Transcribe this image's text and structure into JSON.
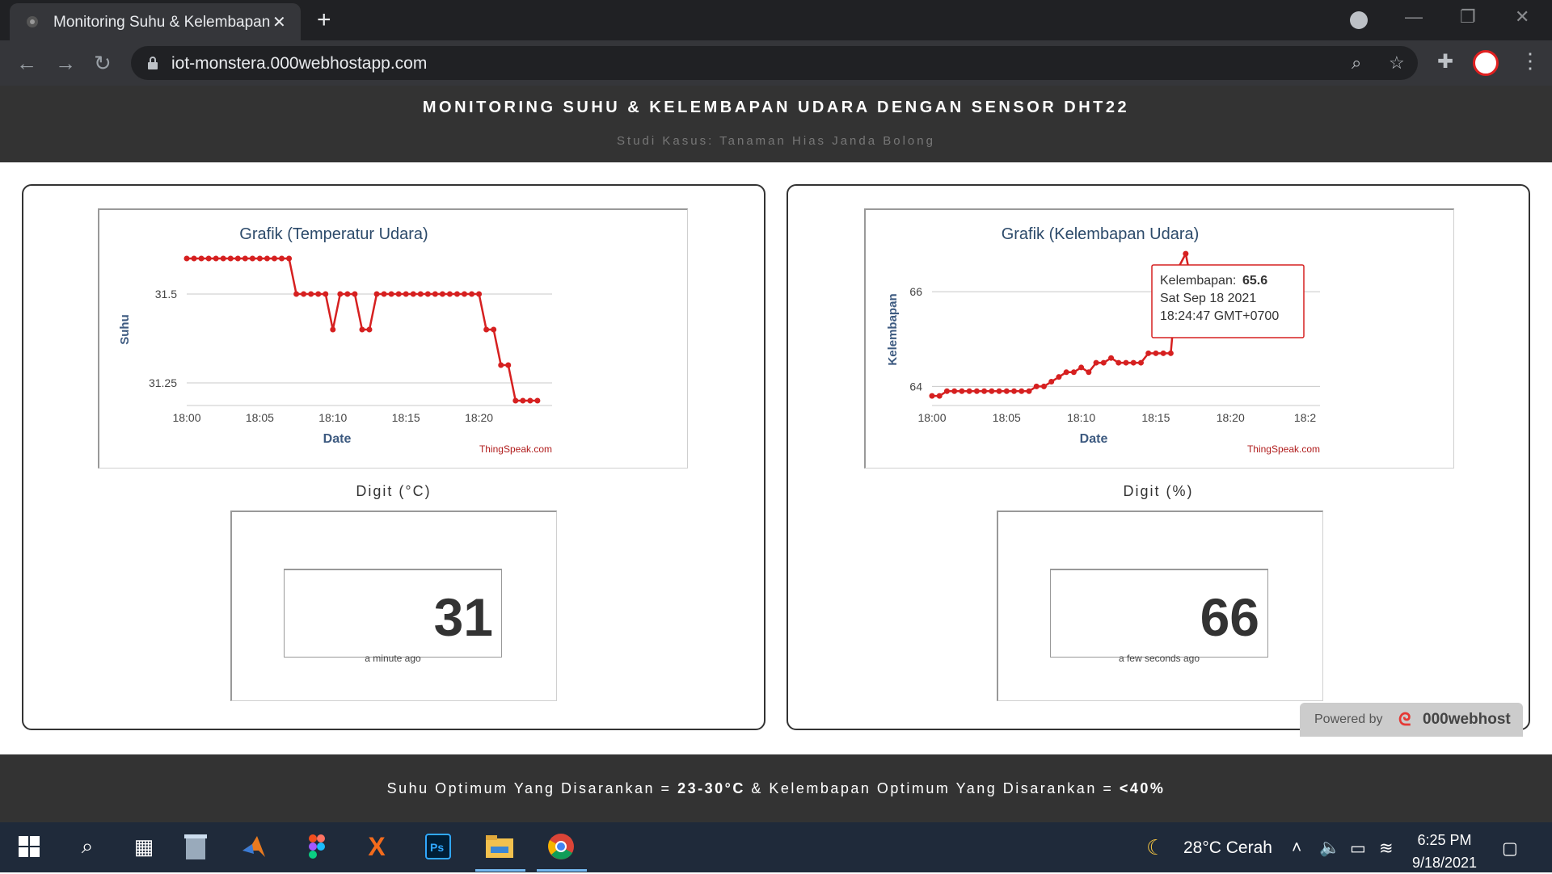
{
  "browser": {
    "tab_title": "Monitoring Suhu & Kelembapan",
    "tab_close": "✕",
    "new_tab": "+",
    "url": "iot-monstera.000webhostapp.com",
    "icons": [
      "back-icon",
      "forward-icon",
      "reload-icon",
      "lock-icon",
      "zoom-icon",
      "star-icon",
      "extensions-icon",
      "menu-icon"
    ]
  },
  "header": {
    "title": "MONITORING SUHU & KELEMBAPAN UDARA DENGAN SENSOR DHT22",
    "subtitle": "Studi Kasus: Tanaman Hias Janda Bolong"
  },
  "temperature": {
    "digit_title": "Digit (°C)",
    "value": "31",
    "updated": "a minute ago"
  },
  "humidity": {
    "digit_title": "Digit (%)",
    "value": "66",
    "updated": "a few seconds ago"
  },
  "footer": {
    "text_1": "Suhu Optimum Yang Disarankan = ",
    "bold_1": "23-30°C",
    "text_2": " & Kelembapan Optimum Yang Disarankan = ",
    "bold_2": "<40%"
  },
  "powered": {
    "label": "Powered by",
    "brand": "000webhost"
  },
  "taskbar": {
    "weather": "28°C  Cerah",
    "time": "6:25 PM",
    "date": "9/18/2021"
  },
  "chart_data": [
    {
      "type": "line",
      "title": "Grafik (Temperatur Udara)",
      "xlabel": "Date",
      "ylabel": "Suhu",
      "credit": "ThingSpeak.com",
      "x_ticks": [
        "18:00",
        "18:05",
        "18:10",
        "18:15",
        "18:20"
      ],
      "y_ticks": [
        "31.5",
        "31.25"
      ],
      "ylim": [
        31.2,
        31.6
      ],
      "x": [
        0,
        0.5,
        1,
        1.5,
        2,
        2.5,
        3,
        3.5,
        4,
        4.5,
        5,
        5.5,
        6,
        6.5,
        7,
        7.5,
        8,
        8.5,
        9,
        9.5,
        10,
        10.5,
        11,
        11.5,
        12,
        12.5,
        13,
        13.5,
        14,
        14.5,
        15,
        15.5,
        16,
        16.5,
        17,
        17.5,
        18,
        18.5,
        19,
        19.5,
        20,
        20.5,
        21,
        21.5,
        22,
        22.5,
        23,
        23.5,
        24
      ],
      "values": [
        31.6,
        31.6,
        31.6,
        31.6,
        31.6,
        31.6,
        31.6,
        31.6,
        31.6,
        31.6,
        31.6,
        31.6,
        31.6,
        31.6,
        31.6,
        31.5,
        31.5,
        31.5,
        31.5,
        31.5,
        31.4,
        31.5,
        31.5,
        31.5,
        31.4,
        31.4,
        31.5,
        31.5,
        31.5,
        31.5,
        31.5,
        31.5,
        31.5,
        31.5,
        31.5,
        31.5,
        31.5,
        31.5,
        31.5,
        31.5,
        31.5,
        31.4,
        31.4,
        31.3,
        31.3,
        31.2,
        31.2,
        31.2,
        31.2
      ],
      "color": "#d62020"
    },
    {
      "type": "line",
      "title": "Grafik (Kelembapan Udara)",
      "xlabel": "Date",
      "ylabel": "Kelembapan",
      "credit": "ThingSpeak.com",
      "x_ticks": [
        "18:00",
        "18:05",
        "18:10",
        "18:15",
        "18:20",
        "18:2"
      ],
      "y_ticks": [
        "66",
        "64"
      ],
      "ylim": [
        63.7,
        66.7
      ],
      "x": [
        0,
        0.5,
        1,
        1.5,
        2,
        2.5,
        3,
        3.5,
        4,
        4.5,
        5,
        5.5,
        6,
        6.5,
        7,
        7.5,
        8,
        8.5,
        9,
        9.5,
        10,
        10.5,
        11,
        11.5,
        12,
        12.5,
        13,
        13.5,
        14,
        14.5,
        15,
        15.5,
        16,
        16.5,
        17,
        17.5,
        18,
        18.5,
        19,
        19.5,
        20,
        20.5,
        21,
        21.5,
        22,
        22.5,
        23,
        23.5,
        24,
        24.5
      ],
      "values": [
        63.8,
        63.8,
        63.9,
        63.9,
        63.9,
        63.9,
        63.9,
        63.9,
        63.9,
        63.9,
        63.9,
        63.9,
        63.9,
        63.9,
        64.0,
        64.0,
        64.1,
        64.2,
        64.3,
        64.3,
        64.4,
        64.3,
        64.5,
        64.5,
        64.6,
        64.5,
        64.5,
        64.5,
        64.5,
        64.7,
        64.7,
        64.7,
        64.7,
        66.5,
        66.8,
        66.0,
        65.6,
        65.4,
        65.3,
        65.4,
        65.3,
        65.5,
        65.4,
        65.5,
        65.6,
        65.7,
        65.8,
        65.9,
        65.9,
        66.0
      ],
      "color": "#d62020",
      "tooltip": {
        "label": "Kelembapan:",
        "value": "65.6",
        "date": "Sat Sep 18 2021",
        "time": "18:24:47 GMT+0700"
      }
    }
  ]
}
